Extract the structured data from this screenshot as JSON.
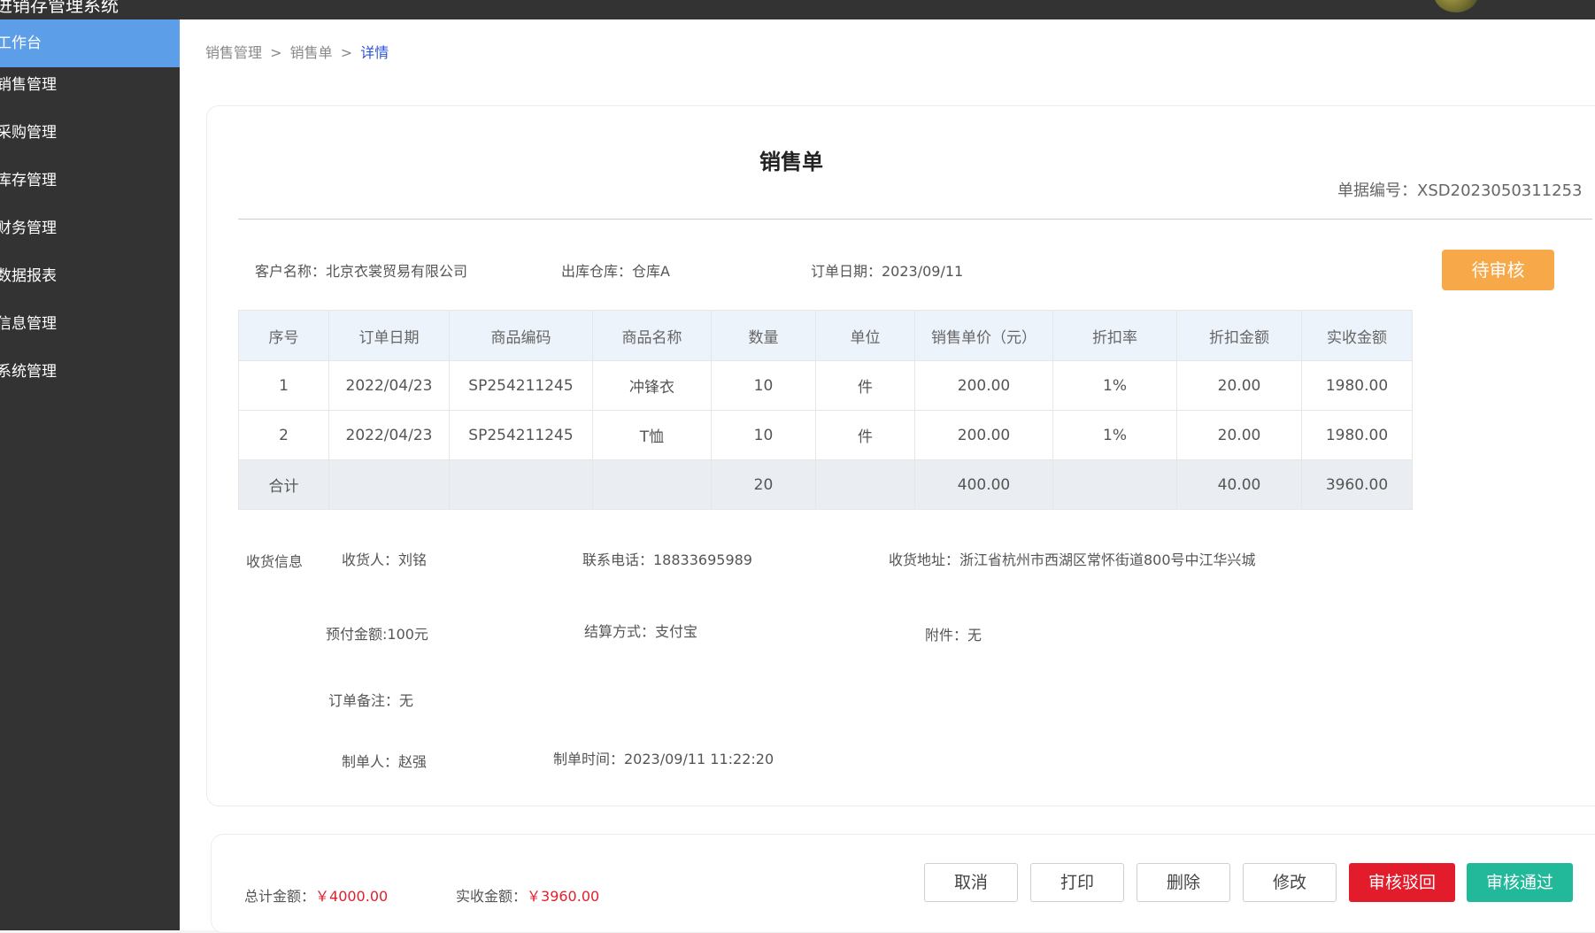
{
  "app": {
    "title": "进销存管理系统"
  },
  "sidebar": {
    "items": [
      {
        "label": "工作台"
      },
      {
        "label": "销售管理"
      },
      {
        "label": "采购管理"
      },
      {
        "label": "库存管理"
      },
      {
        "label": "财务管理"
      },
      {
        "label": "数据报表"
      },
      {
        "label": "信息管理"
      },
      {
        "label": "系统管理"
      }
    ]
  },
  "breadcrumb": {
    "level1": "销售管理",
    "level2": "销售单",
    "current": "详情",
    "separator": ">"
  },
  "order": {
    "title": "销售单",
    "doc_no": "单据编号：XSD2023050311253",
    "customer": "客户名称：北京衣裳贸易有限公司",
    "warehouse": "出库仓库：仓库A",
    "order_date": "订单日期：2023/09/11",
    "status": "待审核"
  },
  "table": {
    "headers": [
      "序号",
      "订单日期",
      "商品编码",
      "商品名称",
      "数量",
      "单位",
      "销售单价（元）",
      "折扣率",
      "折扣金额",
      "实收金额"
    ],
    "rows": [
      [
        "1",
        "2022/04/23",
        "SP254211245",
        "冲锋衣",
        "10",
        "件",
        "200.00",
        "1%",
        "20.00",
        "1980.00"
      ],
      [
        "2",
        "2022/04/23",
        "SP254211245",
        "T恤",
        "10",
        "件",
        "200.00",
        "1%",
        "20.00",
        "1980.00"
      ]
    ],
    "total": [
      "合计",
      "",
      "",
      "",
      "20",
      "",
      "400.00",
      "",
      "40.00",
      "3960.00"
    ]
  },
  "delivery": {
    "section_label": "收货信息",
    "receiver": "收货人：刘铭",
    "phone": "联系电话：18833695989",
    "address": "收货地址：浙江省杭州市西湖区常怀街道800号中江华兴城",
    "prepaid": "预付金额:100元",
    "settlement": "结算方式：支付宝",
    "attachment": "附件：无",
    "remark": "订单备注：无",
    "creator": "制单人：赵强",
    "created_at": "制单时间：2023/09/11 11:22:20"
  },
  "footer": {
    "total_label": "总计金额：",
    "total_value": "￥4000.00",
    "received_label": "实收金额：",
    "received_value": "￥3960.00",
    "buttons": {
      "cancel": "取消",
      "print": "打印",
      "delete": "删除",
      "edit": "修改",
      "reject": "审核驳回",
      "approve": "审核通过"
    }
  },
  "colors": {
    "sidebar_bg": "#333333",
    "sidebar_active": "#5d9ee8",
    "status_pending": "#f7a949",
    "reject": "#e21c2b",
    "approve": "#21b99a",
    "amount_red": "#e0202d"
  }
}
